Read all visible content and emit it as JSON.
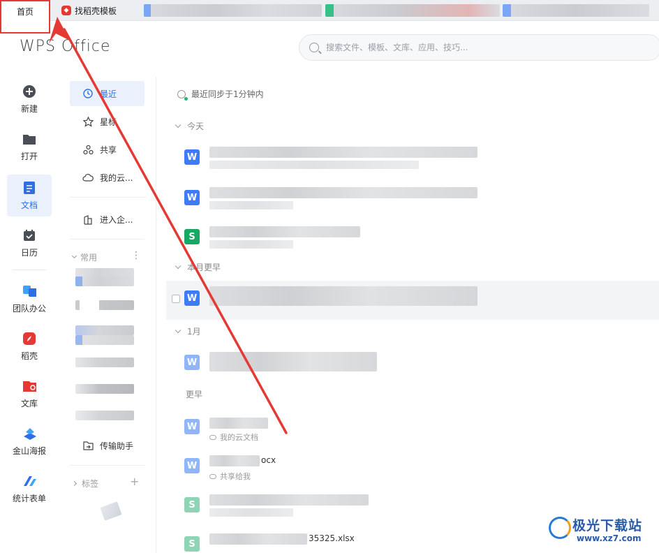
{
  "tabs": {
    "home_label": "首页",
    "docer_label": "找稻壳模板"
  },
  "header": {
    "logo_text": "WPS Office",
    "search_placeholder": "搜索文件、模板、文库、应用、技巧..."
  },
  "rail": {
    "items": [
      {
        "label": "新建",
        "icon": "plus-circle-icon"
      },
      {
        "label": "打开",
        "icon": "folder-icon"
      },
      {
        "label": "文档",
        "icon": "document-icon"
      },
      {
        "label": "日历",
        "icon": "calendar-icon"
      },
      {
        "label": "团队办公",
        "icon": "team-icon"
      },
      {
        "label": "稻壳",
        "icon": "docer-icon"
      },
      {
        "label": "文库",
        "icon": "library-icon"
      },
      {
        "label": "金山海报",
        "icon": "poster-icon"
      },
      {
        "label": "统计表单",
        "icon": "form-icon"
      }
    ]
  },
  "nav": {
    "recent": "最近",
    "starred": "星标",
    "shared": "共享",
    "cloud": "我的云...",
    "enterprise": "进入企...",
    "common_label": "常用",
    "transfer": "传输助手",
    "tags_label": "标签"
  },
  "main": {
    "sync_status": "最近同步于1分钟内",
    "groups": {
      "today": "今天",
      "this_month": "本月更早",
      "january": "1月",
      "earlier": "更早"
    },
    "files": [
      {
        "type": "W",
        "name_tail": "",
        "sub": ""
      },
      {
        "type": "W",
        "name_tail": "",
        "sub": ""
      },
      {
        "type": "S",
        "name_tail": "",
        "sub": ""
      },
      {
        "type": "W",
        "name_tail": "",
        "sub": ""
      },
      {
        "type": "W",
        "name_tail": "",
        "sub": ""
      },
      {
        "type": "W",
        "name_tail": "",
        "sub": "我的云文档"
      },
      {
        "type": "W",
        "name_tail": "ocx",
        "sub": "共享给我"
      },
      {
        "type": "S",
        "name_tail": "",
        "sub": ""
      },
      {
        "type": "S",
        "name_tail": "35325.xlsx",
        "sub": ""
      }
    ]
  },
  "watermark": {
    "brand": "极光下载站",
    "url": "www.xz7.com"
  },
  "colors": {
    "accent": "#2f6fe4",
    "annotation_red": "#e53935",
    "word_blue": "#3d7cf6",
    "sheet_green": "#17a864"
  }
}
